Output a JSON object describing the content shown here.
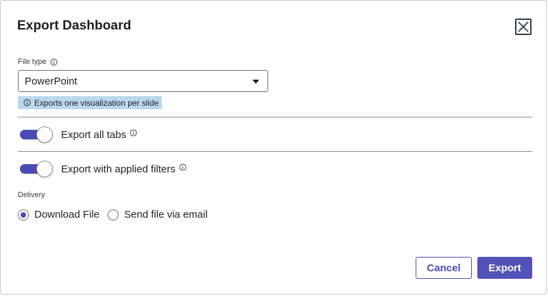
{
  "dialog": {
    "title": "Export Dashboard",
    "close_icon": "close-icon"
  },
  "file_type": {
    "label": "File type",
    "info_icon": "info-icon",
    "selected": "PowerPoint",
    "caret_icon": "caret-down-icon",
    "hint": "Exports one visualization per slide"
  },
  "toggles": [
    {
      "label": "Export all tabs",
      "checked": true,
      "info_icon": "info-icon"
    },
    {
      "label": "Export with applied filters",
      "checked": true,
      "info_icon": "info-icon"
    }
  ],
  "delivery": {
    "label": "Delivery",
    "options": [
      {
        "label": "Download File",
        "checked": true
      },
      {
        "label": "Send file via email",
        "checked": false
      }
    ]
  },
  "actions": {
    "cancel_label": "Cancel",
    "export_label": "Export"
  },
  "colors": {
    "accent": "#4b4bb6",
    "hint_bg": "#b9d8ef",
    "export_bg": "#5252b8"
  }
}
